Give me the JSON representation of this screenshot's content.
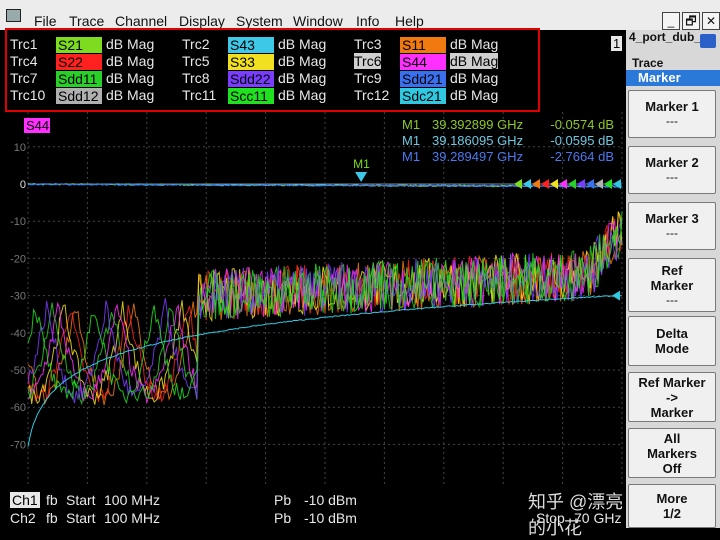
{
  "menu": [
    "File",
    "Trace",
    "Channel",
    "Display",
    "System",
    "Window",
    "Info",
    "Help"
  ],
  "window_buttons": [
    "_",
    "🗗",
    "✕"
  ],
  "channel_number": "1",
  "traces": [
    {
      "name": "Trc1",
      "param": "S21",
      "color": "#7ddc1f",
      "format": "dB Mag"
    },
    {
      "name": "Trc2",
      "param": "S43",
      "color": "#3ec8e8",
      "format": "dB Mag"
    },
    {
      "name": "Trc3",
      "param": "S11",
      "color": "#f07a10",
      "format": "dB Mag"
    },
    {
      "name": "Trc4",
      "param": "S22",
      "color": "#ff2020",
      "format": "dB Mag"
    },
    {
      "name": "Trc5",
      "param": "S33",
      "color": "#f0e020",
      "format": "dB Mag"
    },
    {
      "name": "Trc6",
      "param": "S44",
      "color": "#ff30ff",
      "format": "dB Mag"
    },
    {
      "name": "Trc7",
      "param": "Sdd11",
      "color": "#28d028",
      "format": "dB Mag"
    },
    {
      "name": "Trc8",
      "param": "Sdd22",
      "color": "#7a3cff",
      "format": "dB Mag"
    },
    {
      "name": "Trc9",
      "param": "Sdd21",
      "color": "#3870f0",
      "format": "dB Mag"
    },
    {
      "name": "Trc10",
      "param": "Sdd12",
      "color": "#b0b0b0",
      "format": "dB Mag"
    },
    {
      "name": "Trc11",
      "param": "Scc11",
      "color": "#20e020",
      "format": "dB Mag"
    },
    {
      "name": "Trc12",
      "param": "Sdc21",
      "color": "#30c8e0",
      "format": "dB Mag"
    }
  ],
  "active_trace": "S44",
  "markers": [
    {
      "label": "M1",
      "freq": "39.392899 GHz",
      "value": "-0.0574 dB",
      "color": "#8ec82a"
    },
    {
      "label": "M1",
      "freq": "39.186095 GHz",
      "value": "-0.0595 dB",
      "color": "#6fc8e0"
    },
    {
      "label": "M1",
      "freq": "39.289497 GHz",
      "value": "-2.7664 dB",
      "color": "#4a7af0"
    }
  ],
  "marker_tag": "M1",
  "chart_data": {
    "type": "line",
    "xlabel": "",
    "ylabel": "",
    "x_range_ghz": [
      0.1,
      70
    ],
    "ylim": [
      -80,
      20
    ],
    "yticks": [
      10,
      0,
      -10,
      -20,
      -30,
      -40,
      -50,
      -60,
      -70
    ],
    "grid": true,
    "series": [
      {
        "name": "S21",
        "color": "#7ddc1f",
        "kind": "thru"
      },
      {
        "name": "S43",
        "color": "#3ec8e8",
        "kind": "thru"
      },
      {
        "name": "S11",
        "color": "#f07a10",
        "kind": "refl"
      },
      {
        "name": "S22",
        "color": "#ff2020",
        "kind": "refl"
      },
      {
        "name": "S33",
        "color": "#f0e020",
        "kind": "refl"
      },
      {
        "name": "S44",
        "color": "#ff30ff",
        "kind": "refl"
      },
      {
        "name": "Sdd11",
        "color": "#28d028",
        "kind": "refl"
      },
      {
        "name": "Sdd22",
        "color": "#7a3cff",
        "kind": "refl"
      },
      {
        "name": "Sdd21",
        "color": "#3870f0",
        "kind": "thru"
      },
      {
        "name": "Scc11",
        "color": "#20e020",
        "kind": "refl"
      },
      {
        "name": "Sdc21",
        "color": "#30c8e0",
        "kind": "cross"
      }
    ]
  },
  "footer": {
    "row1": {
      "ch": "Ch1",
      "fb": "fb",
      "start_label": "Start",
      "start": "100 MHz",
      "pb": "Pb",
      "power": "-10 dBm"
    },
    "row2": {
      "ch": "Ch2",
      "fb": "fb",
      "start_label": "Start",
      "start": "100 MHz",
      "pb": "Pb",
      "power": "-10 dBm",
      "stop_label": "Stop",
      "stop": "70 GHz"
    }
  },
  "watermark": "知乎 @漂亮的小花",
  "panel": {
    "title": "4_port_dub_",
    "trace_label": "Trace",
    "marker_label": "Marker",
    "buttons": [
      {
        "l1": "Marker 1",
        "l2": "---"
      },
      {
        "l1": "Marker 2",
        "l2": "---"
      },
      {
        "l1": "Marker 3",
        "l2": "---"
      },
      {
        "l1": "Ref",
        "l2": "Marker",
        "l3": "---"
      },
      {
        "l1": "Delta",
        "l2": "Mode"
      },
      {
        "l1": "Ref Marker",
        "l2": "->",
        "l3": "Marker"
      },
      {
        "l1": "All",
        "l2": "Markers",
        "l3": "Off"
      },
      {
        "l1": "More",
        "l2": "1/2"
      }
    ]
  }
}
